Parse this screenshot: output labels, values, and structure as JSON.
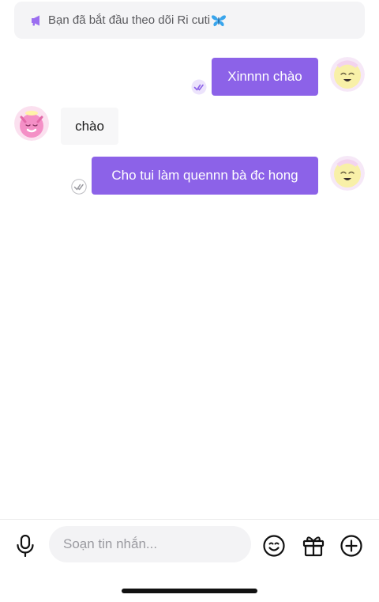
{
  "notice": {
    "text": "Bạn đã bắt đầu theo dõi Ri cuti",
    "icon": "megaphone-icon",
    "emoji": "butterfly-icon"
  },
  "messages": [
    {
      "direction": "outgoing",
      "text": "Xinnnn chào",
      "status": "read"
    },
    {
      "direction": "incoming",
      "text": "chào"
    },
    {
      "direction": "outgoing",
      "text": "Cho tui làm quennn bà đc hong",
      "status": "sent"
    }
  ],
  "composer": {
    "placeholder": "Soạn tin nhắn...",
    "icons": [
      "microphone-icon",
      "emoji-icon",
      "gift-icon",
      "add-icon"
    ]
  },
  "colors": {
    "accent": "#8c62e8",
    "incoming_bubble": "#f7f7f8",
    "notice_bg": "#f4f4f6"
  }
}
